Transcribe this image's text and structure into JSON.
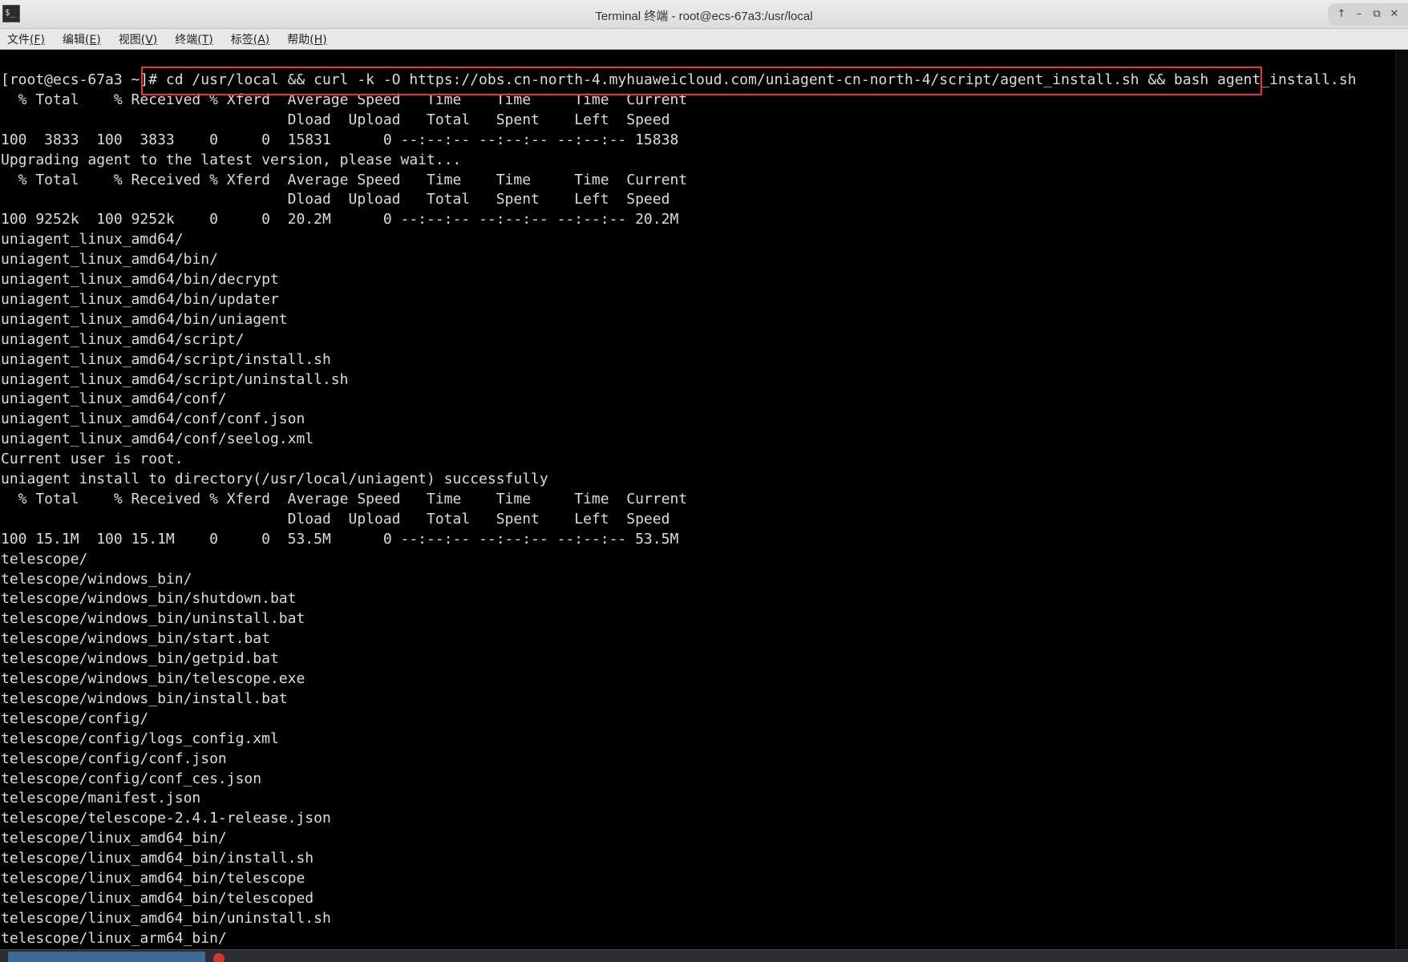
{
  "window": {
    "title": "Terminal 终端 - root@ecs-67a3:/usr/local",
    "app_icon_glyph": "$_"
  },
  "menu": [
    {
      "label": "文件",
      "mnemonic": "(F)"
    },
    {
      "label": "编辑",
      "mnemonic": "(E)"
    },
    {
      "label": "视图",
      "mnemonic": "(V)"
    },
    {
      "label": "终端",
      "mnemonic": "(T)"
    },
    {
      "label": "标签",
      "mnemonic": "(A)"
    },
    {
      "label": "帮助",
      "mnemonic": "(H)"
    }
  ],
  "controls": {
    "up": "↑",
    "minimize": "–",
    "maximize": "⧉",
    "close": "✕"
  },
  "terminal": {
    "prompt": "[root@ecs-67a3 ~]# ",
    "command": "cd /usr/local && curl -k -O https://obs.cn-north-4.myhuaweicloud.com/uniagent-cn-north-4/script/agent_install.sh && bash agent_install.sh",
    "lines": [
      "  % Total    % Received % Xferd  Average Speed   Time    Time     Time  Current",
      "                                 Dload  Upload   Total   Spent    Left  Speed",
      "100  3833  100  3833    0     0  15831      0 --:--:-- --:--:-- --:--:-- 15838",
      "Upgrading agent to the latest version, please wait...",
      "  % Total    % Received % Xferd  Average Speed   Time    Time     Time  Current",
      "                                 Dload  Upload   Total   Spent    Left  Speed",
      "100 9252k  100 9252k    0     0  20.2M      0 --:--:-- --:--:-- --:--:-- 20.2M",
      "uniagent_linux_amd64/",
      "uniagent_linux_amd64/bin/",
      "uniagent_linux_amd64/bin/decrypt",
      "uniagent_linux_amd64/bin/updater",
      "uniagent_linux_amd64/bin/uniagent",
      "uniagent_linux_amd64/script/",
      "uniagent_linux_amd64/script/install.sh",
      "uniagent_linux_amd64/script/uninstall.sh",
      "uniagent_linux_amd64/conf/",
      "uniagent_linux_amd64/conf/conf.json",
      "uniagent_linux_amd64/conf/seelog.xml",
      "Current user is root.",
      "uniagent install to directory(/usr/local/uniagent) successfully",
      "  % Total    % Received % Xferd  Average Speed   Time    Time     Time  Current",
      "                                 Dload  Upload   Total   Spent    Left  Speed",
      "100 15.1M  100 15.1M    0     0  53.5M      0 --:--:-- --:--:-- --:--:-- 53.5M",
      "telescope/",
      "telescope/windows_bin/",
      "telescope/windows_bin/shutdown.bat",
      "telescope/windows_bin/uninstall.bat",
      "telescope/windows_bin/start.bat",
      "telescope/windows_bin/getpid.bat",
      "telescope/windows_bin/telescope.exe",
      "telescope/windows_bin/install.bat",
      "telescope/config/",
      "telescope/config/logs_config.xml",
      "telescope/config/conf.json",
      "telescope/config/conf_ces.json",
      "telescope/manifest.json",
      "telescope/telescope-2.4.1-release.json",
      "telescope/linux_amd64_bin/",
      "telescope/linux_amd64_bin/install.sh",
      "telescope/linux_amd64_bin/telescope",
      "telescope/linux_amd64_bin/telescoped",
      "telescope/linux_amd64_bin/uninstall.sh",
      "telescope/linux_arm64_bin/"
    ]
  },
  "colors": {
    "terminal_bg": "#000000",
    "terminal_fg": "#dcdcdc",
    "highlight_box": "#e8343a",
    "titlebar": "#e6e6e6"
  }
}
